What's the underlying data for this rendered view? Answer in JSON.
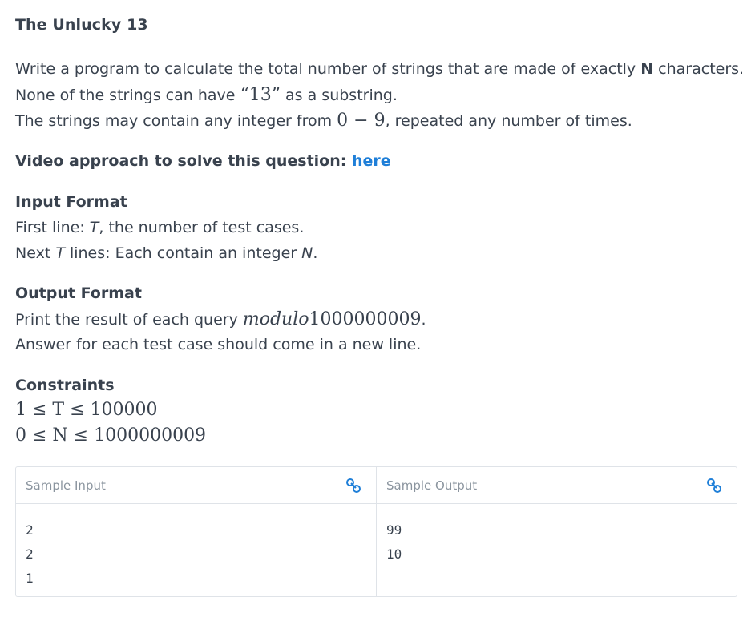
{
  "problem": {
    "title": "The Unlucky 13",
    "statement": {
      "l1_pre": "Write a program to calculate the total number of strings that are made of exactly ",
      "l1_bold": "N",
      "l1_post": " characters.",
      "l2_pre": "None of the strings can have ",
      "l2_math": "“13”",
      "l2_post": " as a substring.",
      "l3_pre": "The strings may contain any integer from ",
      "l3_math": "0 − 9",
      "l3_post": ", repeated any number of times."
    },
    "video": {
      "label": "Video approach to solve this question: ",
      "link_text": "here"
    },
    "input_format": {
      "heading": "Input Format",
      "l1_pre": "First line: ",
      "l1_var": "T",
      "l1_post": ", the number of test cases.",
      "l2_pre": "Next ",
      "l2_var": "T",
      "l2_mid": " lines: Each contain an integer ",
      "l2_var2": "N",
      "l2_post": "."
    },
    "output_format": {
      "heading": "Output Format",
      "l1_pre": "Print the result of each query ",
      "l1_math_it": "modulo",
      "l1_math": "1000000009",
      "l1_post": ".",
      "l2": "Answer for each test case should come in a new line."
    },
    "constraints": {
      "heading": "Constraints",
      "c1": "1 ≤ T ≤ 100000",
      "c2": "0 ≤ N ≤ 1000000009"
    }
  },
  "samples": {
    "input_title": "Sample Input",
    "output_title": "Sample Output",
    "input_lines": [
      "2",
      "2",
      "1"
    ],
    "output_lines": [
      "99",
      "10"
    ],
    "link_icon": "link-icon",
    "link_color": "#1f7fd8"
  }
}
